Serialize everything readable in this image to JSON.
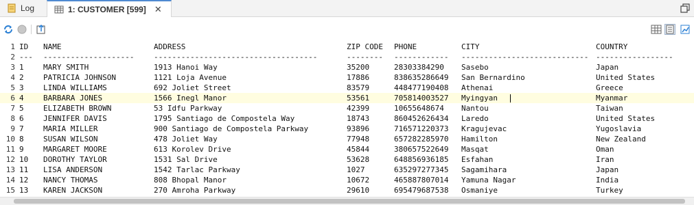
{
  "tabs": [
    {
      "label": "Log",
      "icon": "log-icon"
    },
    {
      "label": "1: CUSTOMER [599]",
      "icon": "table-icon",
      "close": "✕"
    }
  ],
  "toolbar": {
    "icons": [
      "refresh-icon",
      "stop-icon",
      "export-icon"
    ],
    "view_icons": [
      "grid-view-icon",
      "text-view-icon",
      "chart-view-icon"
    ]
  },
  "columns": [
    "ID",
    "NAME",
    "ADDRESS",
    "ZIP CODE",
    "PHONE",
    "CITY",
    "COUNTRY"
  ],
  "separators": [
    "---",
    "--------------------",
    "------------------------------------",
    "--------",
    "------------",
    "----------------------------",
    "-----------------"
  ],
  "line_numbers": [
    "1",
    "2",
    "3",
    "4",
    "5",
    "6",
    "7",
    "8",
    "9",
    "10",
    "11",
    "12",
    "13",
    "14",
    "15"
  ],
  "rows": [
    [
      "1",
      "MARY SMITH",
      "1913 Hanoi Way",
      "35200",
      "28303384290",
      "Sasebo",
      "Japan"
    ],
    [
      "2",
      "PATRICIA JOHNSON",
      "1121 Loja Avenue",
      "17886",
      "838635286649",
      "San Bernardino",
      "United States"
    ],
    [
      "3",
      "LINDA WILLIAMS",
      "692 Joliet Street",
      "83579",
      "448477190408",
      "Athenai",
      "Greece"
    ],
    [
      "4",
      "BARBARA JONES",
      "1566 Inegl Manor",
      "53561",
      "705814003527",
      "Myingyan",
      "Myanmar"
    ],
    [
      "5",
      "ELIZABETH BROWN",
      "53 Idfu Parkway",
      "42399",
      "10655648674",
      "Nantou",
      "Taiwan"
    ],
    [
      "6",
      "JENNIFER DAVIS",
      "1795 Santiago de Compostela Way",
      "18743",
      "860452626434",
      "Laredo",
      "United States"
    ],
    [
      "7",
      "MARIA MILLER",
      "900 Santiago de Compostela Parkway",
      "93896",
      "716571220373",
      "Kragujevac",
      "Yugoslavia"
    ],
    [
      "8",
      "SUSAN WILSON",
      "478 Joliet Way",
      "77948",
      "657282285970",
      "Hamilton",
      "New Zealand"
    ],
    [
      "9",
      "MARGARET MOORE",
      "613 Korolev Drive",
      "45844",
      "380657522649",
      "Masqat",
      "Oman"
    ],
    [
      "10",
      "DOROTHY TAYLOR",
      "1531 Sal Drive",
      "53628",
      "648856936185",
      "Esfahan",
      "Iran"
    ],
    [
      "11",
      "LISA ANDERSON",
      "1542 Tarlac Parkway",
      "1027",
      "635297277345",
      "Sagamihara",
      "Japan"
    ],
    [
      "12",
      "NANCY THOMAS",
      "808 Bhopal Manor",
      "10672",
      "465887807014",
      "Yamuna Nagar",
      "India"
    ],
    [
      "13",
      "KAREN JACKSON",
      "270 Amroha Parkway",
      "29610",
      "695479687538",
      "Osmaniye",
      "Turkey"
    ]
  ],
  "highlighted_row": 3
}
